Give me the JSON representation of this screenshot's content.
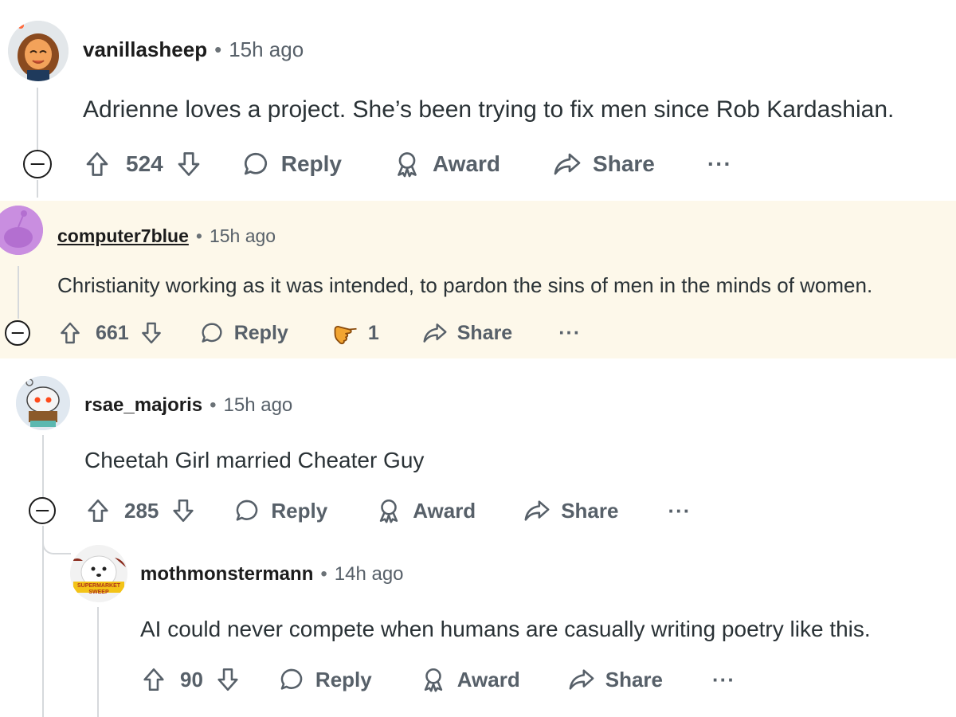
{
  "comments": [
    {
      "username": "vanillasheep",
      "separator": "•",
      "time": "15h ago",
      "text": "Adrienne loves a project. She’s been trying to fix men since Rob Kardashian.",
      "score": "524",
      "reply": "Reply",
      "award": "Award",
      "share": "Share",
      "more": "···"
    },
    {
      "username": "computer7blue",
      "separator": "•",
      "time": "15h ago",
      "text": "Christianity working as it was intended, to pardon the sins of men in the minds of women.",
      "score": "661",
      "reply": "Reply",
      "award_count": "1",
      "share": "Share",
      "more": "···"
    },
    {
      "username": "rsae_majoris",
      "separator": "•",
      "time": "15h ago",
      "text": "Cheetah Girl married Cheater Guy",
      "score": "285",
      "reply": "Reply",
      "award": "Award",
      "share": "Share",
      "more": "···"
    },
    {
      "username": "mothmonstermann",
      "separator": "•",
      "time": "14h ago",
      "text": "AI could never compete when humans are casually writing poetry like this.",
      "score": "90",
      "reply": "Reply",
      "award": "Award",
      "share": "Share",
      "more": "···",
      "avatar_caption": "SUPERMARKET SWEEP"
    }
  ],
  "colors": {
    "highlight_bg": "#fdf8ea",
    "meta_text": "#576069",
    "award_gold": "#f2a531"
  }
}
